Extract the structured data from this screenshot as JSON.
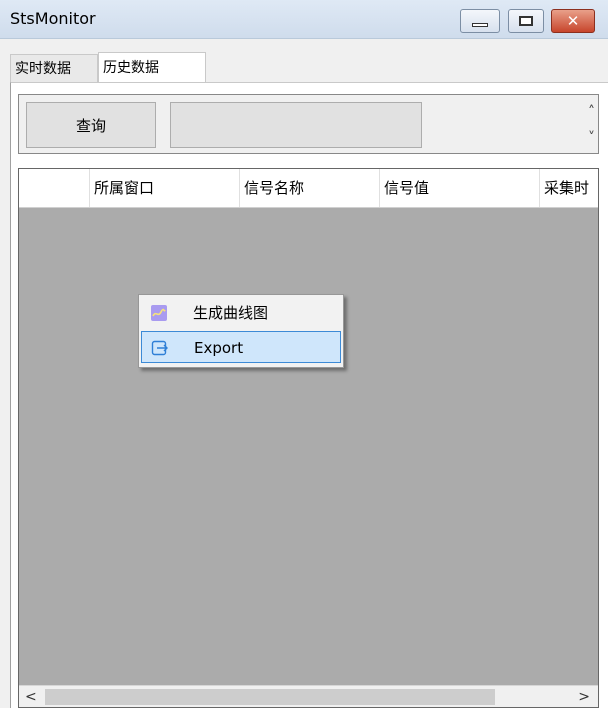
{
  "window": {
    "title": "StsMonitor"
  },
  "controls": {
    "minimize": "minimize",
    "maximize": "maximize",
    "close": "close"
  },
  "tabs": [
    {
      "label": "实时数据",
      "active": false
    },
    {
      "label": "历史数据",
      "active": true
    }
  ],
  "toolbar": {
    "query_label": "查询",
    "input_value": ""
  },
  "grid": {
    "columns": [
      "",
      "所属窗口",
      "信号名称",
      "信号值",
      "采集时"
    ]
  },
  "context_menu": {
    "items": [
      {
        "label": "生成曲线图",
        "icon": "chart-icon"
      },
      {
        "label": "Export",
        "icon": "export-icon",
        "highlighted": true
      }
    ]
  },
  "colors": {
    "grid_background": "#ababab",
    "menu_highlight": "#cfe6fb",
    "menu_highlight_border": "#3c8ad6"
  }
}
